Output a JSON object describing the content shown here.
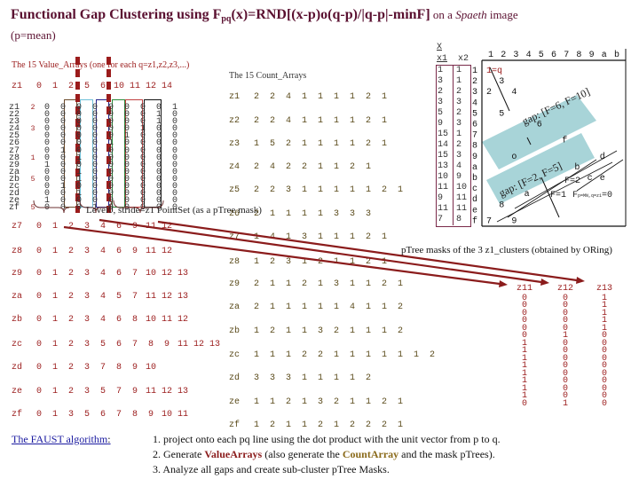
{
  "title": {
    "prefix": "Functional Gap Clustering using F",
    "subscript": "pq",
    "formula": "(x)=RND[(x-p)o(q-p)/|q-p|-minF]",
    "suffix_on": " on a ",
    "suffix_italic": "Spaeth",
    "suffix_end": " image",
    "line2": "(p=mean)"
  },
  "value_arrays": {
    "heading": "The 15 Value_Arrays (one for each q=z1,z2,z3,...)",
    "header_row": [
      "z1",
      "0",
      "1",
      "2",
      "5",
      "6",
      "10",
      "11",
      "12",
      "14"
    ],
    "bit_rows": [
      {
        "label": "z1",
        "mark": "2",
        "bits": [
          "0",
          "0",
          "0",
          "0",
          "0",
          "0",
          "0",
          "0",
          "1"
        ]
      },
      {
        "label": "z2",
        "mark": "",
        "bits": [
          "0",
          "0",
          "0",
          "0",
          "0",
          "0",
          "0",
          "1",
          "0"
        ]
      },
      {
        "label": "z3",
        "mark": "",
        "bits": [
          "0",
          "0",
          "0",
          "0",
          "0",
          "0",
          "0",
          "1",
          "0"
        ]
      },
      {
        "label": "z4",
        "mark": "3",
        "bits": [
          "0",
          "0",
          "0",
          "0",
          "0",
          "0",
          "1",
          "0",
          "0"
        ]
      },
      {
        "label": "z5",
        "mark": "",
        "bits": [
          "0",
          "0",
          "0",
          "0",
          "0",
          "1",
          "0",
          "0",
          "0"
        ]
      },
      {
        "label": "z6",
        "mark": "",
        "bits": [
          "0",
          "0",
          "0",
          "0",
          "1",
          "0",
          "0",
          "0",
          "0"
        ]
      },
      {
        "label": "z7",
        "mark": "",
        "bits": [
          "0",
          "1",
          "0",
          "0",
          "0",
          "0",
          "0",
          "0",
          "0"
        ]
      },
      {
        "label": "z8",
        "mark": "1",
        "bits": [
          "0",
          "0",
          "1",
          "0",
          "0",
          "0",
          "0",
          "0",
          "0"
        ]
      },
      {
        "label": "z9",
        "mark": "",
        "bits": [
          "1",
          "0",
          "0",
          "0",
          "0",
          "0",
          "0",
          "0",
          "0"
        ]
      },
      {
        "label": "za",
        "mark": "",
        "bits": [
          "0",
          "0",
          "1",
          "0",
          "0",
          "0",
          "0",
          "0",
          "0"
        ]
      },
      {
        "label": "zb",
        "mark": "5",
        "bits": [
          "0",
          "0",
          "1",
          "0",
          "0",
          "0",
          "0",
          "0",
          "0"
        ]
      },
      {
        "label": "zc",
        "mark": "",
        "bits": [
          "0",
          "1",
          "0",
          "0",
          "0",
          "0",
          "0",
          "0",
          "0"
        ]
      },
      {
        "label": "zd",
        "mark": "",
        "bits": [
          "0",
          "0",
          "1",
          "0",
          "0",
          "0",
          "0",
          "0",
          "0"
        ]
      },
      {
        "label": "ze",
        "mark": "",
        "bits": [
          "1",
          "0",
          "0",
          "0",
          "0",
          "0",
          "0",
          "0",
          "0"
        ]
      },
      {
        "label": "zf",
        "mark": "5",
        "bits": [
          "0",
          "0",
          "0",
          "1",
          "0",
          "0",
          "0",
          "0",
          "0"
        ]
      }
    ],
    "level_caption": "Level0, stride=z1 PointSet (as a pTree mask)",
    "rows": [
      {
        "label": "z7",
        "values": [
          "0",
          "1",
          "2",
          "3",
          "4",
          "6",
          "9",
          "11",
          "12"
        ]
      },
      {
        "label": "z8",
        "values": [
          "0",
          "1",
          "2",
          "3",
          "4",
          "6",
          "9",
          "11",
          "12"
        ]
      },
      {
        "label": "z9",
        "values": [
          "0",
          "1",
          "2",
          "3",
          "4",
          "6",
          "7",
          "10",
          "12",
          "13"
        ]
      },
      {
        "label": "za",
        "values": [
          "0",
          "1",
          "2",
          "3",
          "4",
          "5",
          "7",
          "11",
          "12",
          "13"
        ]
      },
      {
        "label": "zb",
        "values": [
          "0",
          "1",
          "2",
          "3",
          "4",
          "6",
          "8",
          "10",
          "11",
          "12"
        ]
      },
      {
        "label": "zc",
        "values": [
          "0",
          "1",
          "2",
          "3",
          "5",
          "6",
          "7",
          "8",
          "9",
          "11",
          "12",
          "13"
        ]
      },
      {
        "label": "zd",
        "values": [
          "0",
          "1",
          "2",
          "3",
          "7",
          "8",
          "9",
          "10"
        ]
      },
      {
        "label": "ze",
        "values": [
          "0",
          "1",
          "2",
          "3",
          "5",
          "7",
          "9",
          "11",
          "12",
          "13"
        ]
      },
      {
        "label": "zf",
        "values": [
          "0",
          "1",
          "3",
          "5",
          "6",
          "7",
          "8",
          "9",
          "10",
          "11"
        ]
      }
    ]
  },
  "count_arrays": {
    "heading": "The 15 Count_Arrays",
    "rows": [
      {
        "label": "z1",
        "values": [
          "2",
          "2",
          "4",
          "1",
          "1",
          "1",
          "1",
          "2",
          "1"
        ]
      },
      {
        "label": "z2",
        "values": [
          "2",
          "2",
          "4",
          "1",
          "1",
          "1",
          "1",
          "2",
          "1"
        ]
      },
      {
        "label": "z3",
        "values": [
          "1",
          "5",
          "2",
          "1",
          "1",
          "1",
          "1",
          "2",
          "1"
        ]
      },
      {
        "label": "z4",
        "values": [
          "2",
          "4",
          "2",
          "2",
          "1",
          "1",
          "2",
          "1"
        ]
      },
      {
        "label": "z5",
        "values": [
          "2",
          "2",
          "3",
          "1",
          "1",
          "1",
          "1",
          "1",
          "2",
          "1"
        ]
      },
      {
        "label": "z6",
        "values": [
          "2",
          "1",
          "1",
          "1",
          "1",
          "3",
          "3",
          "3"
        ]
      },
      {
        "label": "z7",
        "values": [
          "1",
          "4",
          "1",
          "3",
          "1",
          "1",
          "1",
          "2",
          "1"
        ]
      },
      {
        "label": "z8",
        "values": [
          "1",
          "2",
          "3",
          "1",
          "2",
          "1",
          "1",
          "2",
          "1"
        ]
      },
      {
        "label": "z9",
        "values": [
          "2",
          "1",
          "1",
          "2",
          "1",
          "3",
          "1",
          "1",
          "2",
          "1"
        ]
      },
      {
        "label": "za",
        "values": [
          "2",
          "1",
          "1",
          "1",
          "1",
          "1",
          "4",
          "1",
          "1",
          "2"
        ]
      },
      {
        "label": "zb",
        "values": [
          "1",
          "2",
          "1",
          "1",
          "3",
          "2",
          "1",
          "1",
          "1",
          "2"
        ]
      },
      {
        "label": "zc",
        "values": [
          "1",
          "1",
          "1",
          "2",
          "2",
          "1",
          "1",
          "1",
          "1",
          "1",
          "1",
          "2"
        ]
      },
      {
        "label": "zd",
        "values": [
          "3",
          "3",
          "3",
          "1",
          "1",
          "1",
          "1",
          "2"
        ]
      },
      {
        "label": "ze",
        "values": [
          "1",
          "1",
          "2",
          "1",
          "3",
          "2",
          "1",
          "1",
          "2",
          "1"
        ]
      },
      {
        "label": "zf",
        "values": [
          "1",
          "2",
          "1",
          "1",
          "2",
          "1",
          "2",
          "2",
          "2",
          "1"
        ]
      }
    ]
  },
  "x_table": {
    "title": "X",
    "headers": [
      "x1",
      "x2"
    ],
    "rows": [
      [
        "1",
        "1"
      ],
      [
        "3",
        "1"
      ],
      [
        "2",
        "2"
      ],
      [
        "3",
        "3"
      ],
      [
        "5",
        "2"
      ],
      [
        "9",
        "3"
      ],
      [
        "15",
        "1"
      ],
      [
        "14",
        "2"
      ],
      [
        "15",
        "3"
      ],
      [
        "13",
        "4"
      ],
      [
        "10",
        "9"
      ],
      [
        "11",
        "10"
      ],
      [
        "9",
        "11"
      ],
      [
        "11",
        "11"
      ],
      [
        "7",
        "8"
      ]
    ]
  },
  "plot": {
    "x_ticks": [
      "1",
      "2",
      "3",
      "4",
      "5",
      "6",
      "7",
      "8",
      "9",
      "a",
      "b"
    ],
    "y_ticks": [
      "1",
      "2",
      "3",
      "4",
      "5",
      "6",
      "7",
      "8",
      "9",
      "a",
      "b",
      "c",
      "d",
      "e",
      "f"
    ],
    "q_label": "1=q",
    "points": [
      {
        "id": "2",
        "x": 1,
        "y": 3
      },
      {
        "id": "3",
        "x": 2,
        "y": 2
      },
      {
        "id": "4",
        "x": 3,
        "y": 3
      },
      {
        "id": "5",
        "x": 2,
        "y": 5
      },
      {
        "id": "6",
        "x": 5,
        "y": 6
      },
      {
        "id": "f",
        "x": 7,
        "y": 7.5
      },
      {
        "id": "o",
        "x": 3,
        "y": 9
      },
      {
        "id": "d",
        "x": 10,
        "y": 9
      },
      {
        "id": "b",
        "x": 8,
        "y": 10
      },
      {
        "id": "c",
        "x": 9,
        "y": 11
      },
      {
        "id": "e",
        "x": 10,
        "y": 11
      },
      {
        "id": "a",
        "x": 4,
        "y": 12.5
      },
      {
        "id": "8",
        "x": 2,
        "y": 13.5
      },
      {
        "id": "7",
        "x": 1,
        "y": 15
      },
      {
        "id": "9",
        "x": 3,
        "y": 15
      }
    ],
    "gap1_label": "gap: [F=6, F=10]",
    "gap2_label": "gap: [F=2, F=5]",
    "f2_label": "F=2",
    "f1_label": "F=1",
    "f0_label": "F",
    "f0_sub": "p=MN,q=z1",
    "f0_eq": "=0"
  },
  "ptree_masks": {
    "heading": "pTree masks of the 3 z1_clusters (obtained by ORing)",
    "columns": [
      {
        "name": "z11",
        "bits": [
          "0",
          "0",
          "0",
          "0",
          "0",
          "0",
          "1",
          "1",
          "1",
          "1",
          "1",
          "1",
          "1",
          "1",
          "0"
        ]
      },
      {
        "name": "z12",
        "bits": [
          "0",
          "0",
          "0",
          "0",
          "0",
          "1",
          "0",
          "0",
          "0",
          "0",
          "0",
          "0",
          "0",
          "0",
          "1"
        ]
      },
      {
        "name": "z13",
        "bits": [
          "1",
          "1",
          "1",
          "1",
          "1",
          "0",
          "0",
          "0",
          "0",
          "0",
          "0",
          "0",
          "0",
          "0",
          "0"
        ]
      }
    ]
  },
  "faust_link": "The FAUST algorithm",
  "faust_colon": ":",
  "steps": {
    "s1": "1. project onto each pq line using the dot product with the unit vector from p to q.",
    "s2_a": "2. Generate ",
    "s2_va": "ValueArrays",
    "s2_b": " (also generate the ",
    "s2_ca": "CountArray",
    "s2_c": " and the mask pTrees).",
    "s3": "3. Analyze all gaps and create sub-cluster pTree Masks."
  },
  "colors": {
    "title": "#5a1030",
    "accent_red": "#9b1c1c",
    "gap_band": "#a8d4d8",
    "link": "#1a1aa0"
  }
}
